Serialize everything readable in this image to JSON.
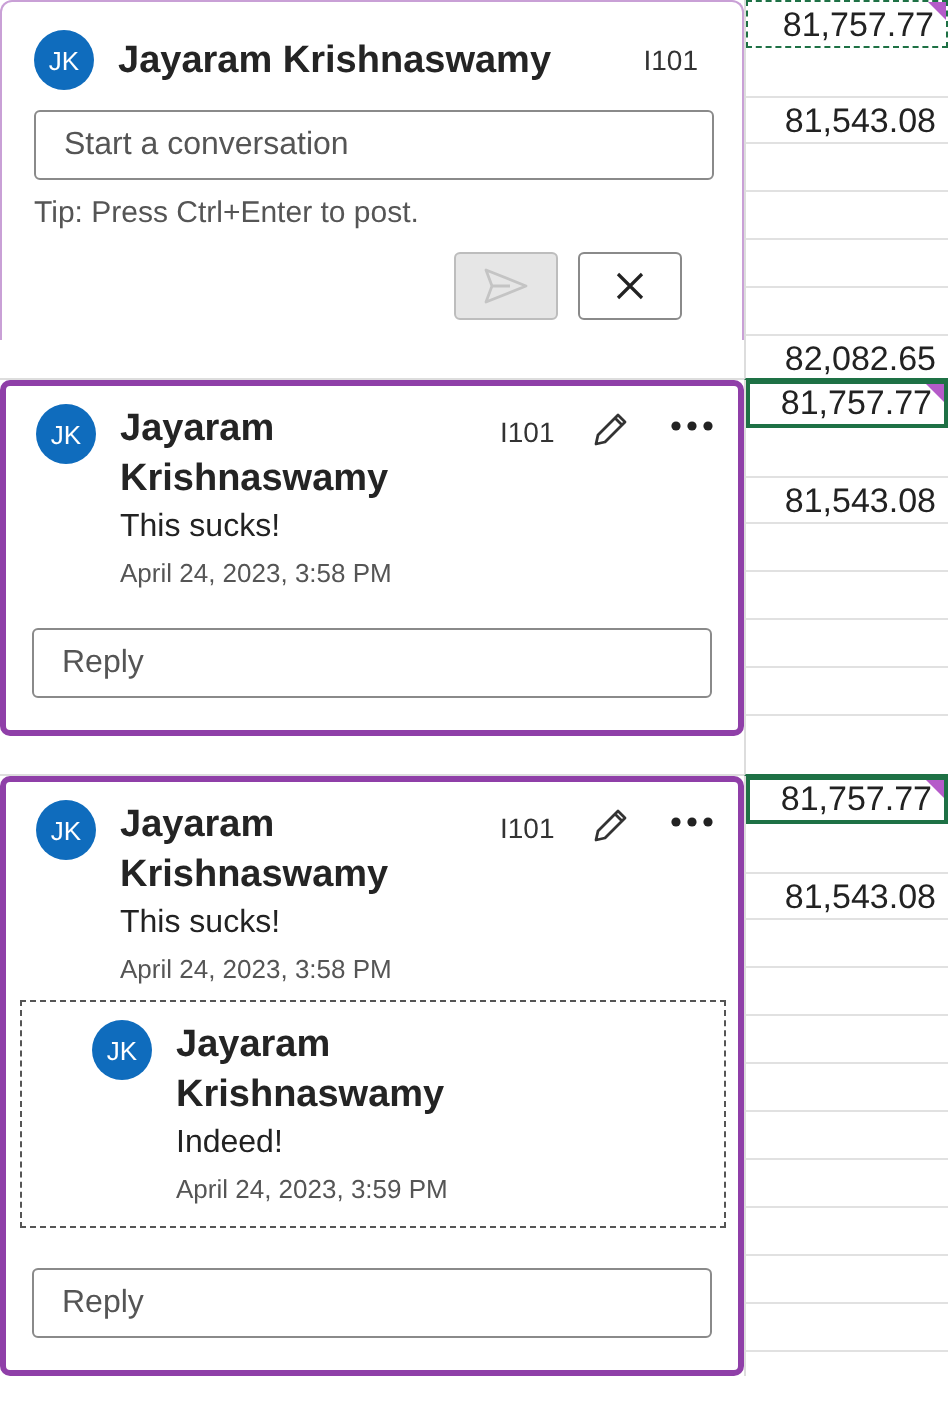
{
  "sections": [
    {
      "kind": "view",
      "card": {
        "kind": "draft",
        "active": false,
        "cell_ref": "I101",
        "author": {
          "initials": "JK",
          "name": "Jayaram Krishnaswamy"
        },
        "input": {
          "placeholder": "Start a conversation"
        },
        "tip": "Tip: Press Ctrl+Enter to post.",
        "send_disabled": true
      },
      "cells": [
        {
          "text": "81,757.77",
          "selected": false,
          "copied": true,
          "comment_marker": true
        },
        {
          "text": "81,543.08",
          "selected": false,
          "copied": false,
          "comment_marker": false
        }
      ]
    },
    {
      "kind": "strip",
      "text": "82,082.65"
    },
    {
      "kind": "view",
      "card": {
        "kind": "thread",
        "active": true,
        "cell_ref": "I101",
        "comments": [
          {
            "initials": "JK",
            "name": "Jayaram Krishnaswamy",
            "text": "This sucks!",
            "date": "April 24, 2023, 3:58 PM",
            "focused": false
          }
        ],
        "reply": {
          "placeholder": "Reply"
        }
      },
      "cells": [
        {
          "text": "81,757.77",
          "selected": true,
          "copied": false,
          "comment_marker": true
        },
        {
          "text": "81,543.08",
          "selected": false,
          "copied": false,
          "comment_marker": false
        }
      ]
    },
    {
      "kind": "strip"
    },
    {
      "kind": "view",
      "card": {
        "kind": "thread",
        "active": true,
        "cell_ref": "I101",
        "comments": [
          {
            "initials": "JK",
            "name": "Jayaram Krishnaswamy",
            "text": "This sucks!",
            "date": "April 24, 2023, 3:58 PM",
            "focused": false
          },
          {
            "initials": "JK",
            "name": "Jayaram Krishnaswamy",
            "text": "Indeed!",
            "date": "April 24, 2023, 3:59 PM",
            "focused": true
          }
        ],
        "reply": {
          "placeholder": "Reply"
        }
      },
      "cells": [
        {
          "text": "81,757.77",
          "selected": true,
          "copied": false,
          "comment_marker": true
        },
        {
          "text": "81,543.08",
          "selected": false,
          "copied": false,
          "comment_marker": false
        }
      ]
    }
  ]
}
